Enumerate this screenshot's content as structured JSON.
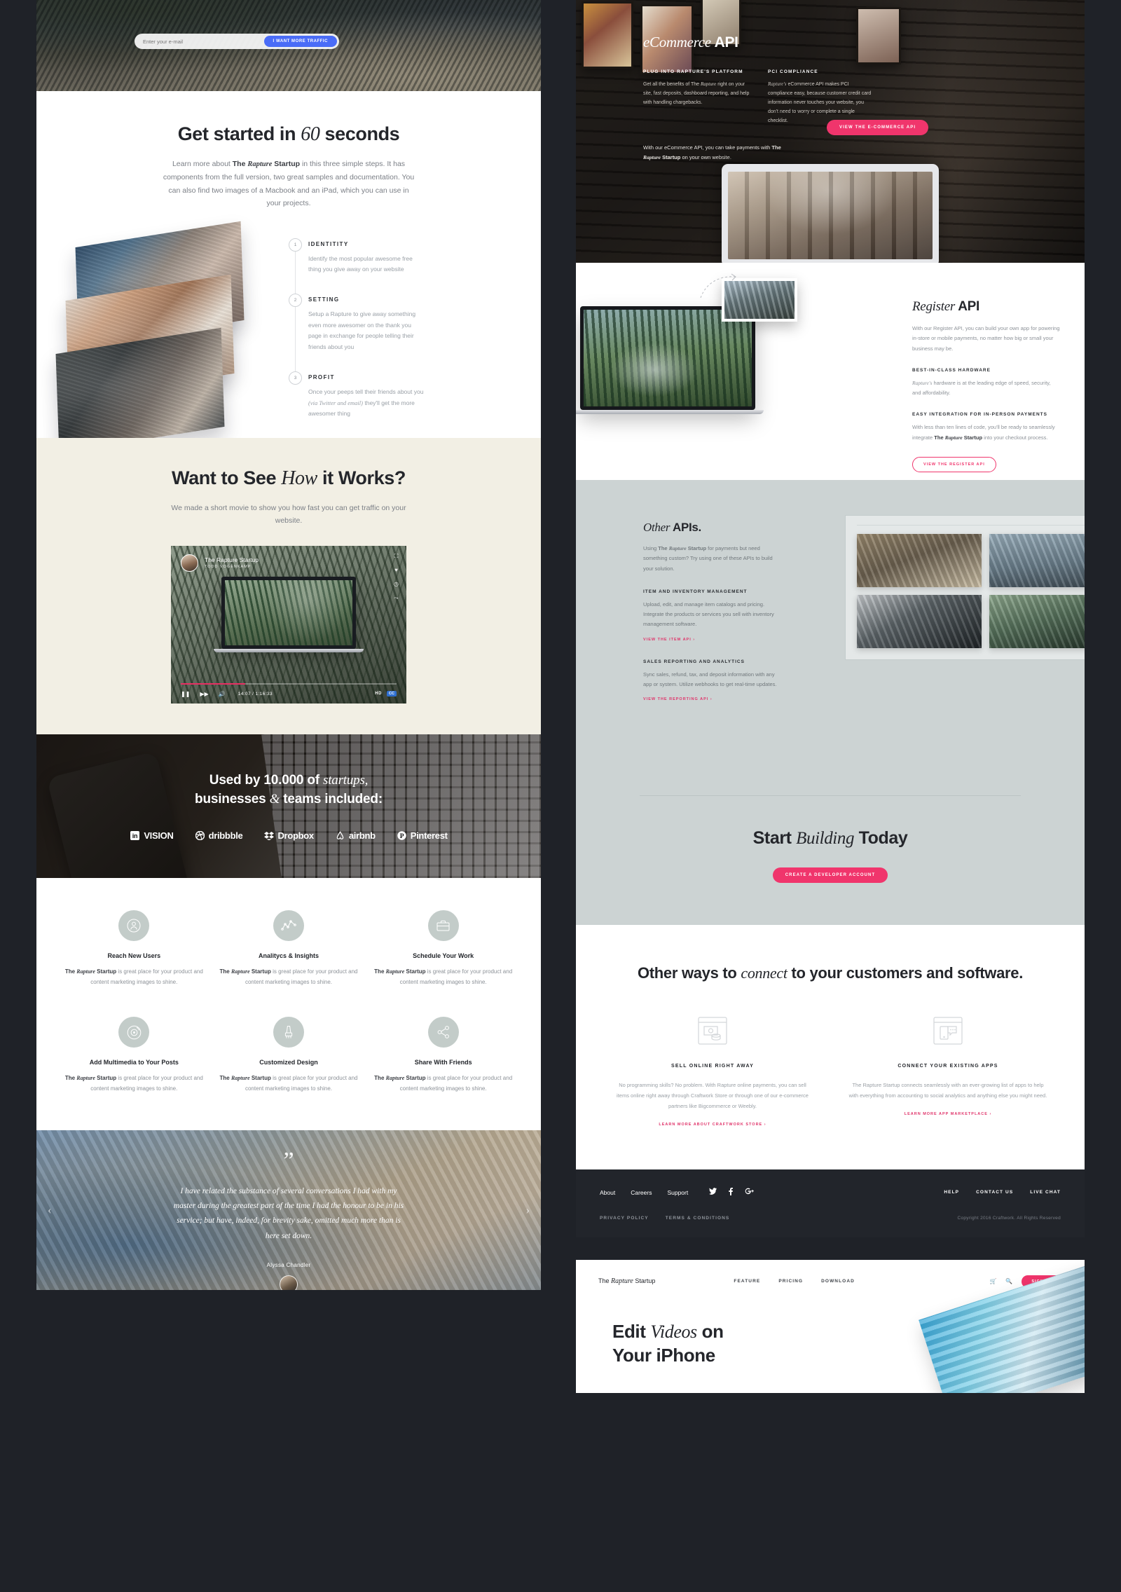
{
  "hero": {
    "email_placeholder": "Enter your e-mail",
    "cta": "I WANT MORE TRAFFIC"
  },
  "get_started": {
    "title_a": "Get started in ",
    "title_em": "60",
    "title_b": " seconds",
    "lead_a": "Learn more about ",
    "lead_bold_a": "The ",
    "lead_bold_em": "Rapture",
    "lead_bold_b": " Startup",
    "lead_b": " in this three simple steps. It has components from the full version, two great samples and documentation. You can also find two images of a Macbook and an iPad, which you can use in your projects.",
    "steps": [
      {
        "num": "1",
        "title": "IDENTITITY",
        "body": "Identify the most popular awesome free thing you give away on your website"
      },
      {
        "num": "2",
        "title": "SETTING",
        "body": "Setup a Rapture to give away something even more awesomer on the thank you page in exchange for people telling their friends about you"
      },
      {
        "num": "3",
        "title": "PROFIT",
        "body_a": "Once your peeps tell their friends about you ",
        "body_em": "(via Twitter and email)",
        "body_b": " they'll get the more awesomer thing"
      }
    ]
  },
  "video": {
    "title_a": "Want to See ",
    "title_em": "How",
    "title_b": " it Works?",
    "lead": "We made a short movie to show you how fast you can get traffic on your website.",
    "channel": "The Rapture Startup",
    "author": "TODD VOGENKAMP",
    "time": "14:07 / 1:16:33",
    "quality": "HD",
    "cc": "CC",
    "icons": [
      "fullscreen-icon",
      "heart-icon",
      "clock-icon",
      "share-icon"
    ]
  },
  "logos": {
    "title_a": "Used by 10.000 of ",
    "title_em": "startups,",
    "title_b": "businesses ",
    "title_em2": "&",
    "title_c": " teams included:",
    "items": [
      "in vision",
      "dribbble",
      "Dropbox",
      "airbnb",
      "Pinterest"
    ]
  },
  "features": [
    {
      "icon": "user-icon",
      "name": "Reach New Users",
      "t_bold_a": "The ",
      "t_bold_em": "Rapture",
      "t_bold_b": " Startup",
      "text": " is great place for your product and content marketing images to shine."
    },
    {
      "icon": "chart-line-icon",
      "name": "Analitycs & Insights",
      "t_bold_a": "The ",
      "t_bold_em": "Rapture",
      "t_bold_b": " Startup",
      "text": " is great place for your product and content marketing images to shine."
    },
    {
      "icon": "briefcase-icon",
      "name": "Schedule Your Work",
      "t_bold_a": "The ",
      "t_bold_em": "Rapture",
      "t_bold_b": " Startup",
      "text": " is great place for your product and content marketing images to shine."
    },
    {
      "icon": "disc-icon",
      "name": "Add Multimedia to Your Posts",
      "t_bold_a": "The ",
      "t_bold_em": "Rapture",
      "t_bold_b": " Startup",
      "text": " is great place for your product and content marketing images to shine."
    },
    {
      "icon": "brush-icon",
      "name": "Customized Design",
      "t_bold_a": "The ",
      "t_bold_em": "Rapture",
      "t_bold_b": " Startup",
      "text": " is great place for your product and content marketing images to shine."
    },
    {
      "icon": "share-nodes-icon",
      "name": "Share With Friends",
      "t_bold_a": "The ",
      "t_bold_em": "Rapture",
      "t_bold_b": " Startup",
      "text": " is great place for your product and content marketing images to shine."
    }
  ],
  "testimonial": {
    "quote_mark": "”",
    "quote": "I have related the substance of several conversations I had with my master during the greatest part of the time I had the honour to be in his service; but have, indeed, for brevity sake, omitted much more than is here set down.",
    "author": "Alyssa Chandler",
    "prev": "‹",
    "next": "›"
  },
  "ecommerce": {
    "title_em": "eCommerce",
    "title_b": " API",
    "col1_title": "PLUG INTO RAPTURE'S PLATFORM",
    "col1_body_a": "Get all the benefits of The ",
    "col1_body_em": "Rapture",
    "col1_body_b": " right on your site, fast deposits, dashboard reporting, and help with handling chargebacks.",
    "col2_title": "PCI COMPLIANCE",
    "col2_body_a": "Rapture's",
    "col2_body_b": " eCommerce API makes PCI compliance easy, because customer credit card information never touches your website, you don't need to worry or complete a single checklist.",
    "footer_a": "With our eCommerce API, you can take payments with ",
    "footer_bold_a": "The ",
    "footer_bold_em": "Rapture",
    "footer_bold_b": " Startup",
    "footer_b": " on your own website.",
    "cta": "VIEW THE E-COMMERCE API"
  },
  "register": {
    "title_em": "Register",
    "title_b": " API",
    "body": "With our Register API, you can build your own app for powering in-store or mobile payments, no matter how big or small your business may be.",
    "sub1": "BEST-IN-CLASS HARDWARE",
    "sub1_body_em": "Rapture's",
    "sub1_body": " hardware is at the leading edge of speed, security, and affordability.",
    "sub2": "EASY INTEGRATION FOR IN-PERSON PAYMENTS",
    "sub2_body_a": "With less than ten lines of code, you'll be ready to seamlessly integrate ",
    "sub2_bold_a": "The ",
    "sub2_bold_em": "Rapture",
    "sub2_bold_b": " Startup",
    "sub2_body_b": " into your checkout process.",
    "cta": "VIEW THE REGISTER API"
  },
  "other_apis": {
    "title_em": "Other",
    "title_b": " APIs.",
    "body_a": "Using ",
    "body_bold_a": "The ",
    "body_bold_em": "Rapture",
    "body_bold_b": " Startup",
    "body_b": " for payments but need something custom? Try using one of these APIs to build your solution.",
    "sub1": "ITEM AND INVENTORY MANAGEMENT",
    "sub1_body": "Upload, edit, and manage item catalogs and pricing. Integrate the products or services you sell with inventory management software.",
    "link1": "VIEW THE ITEM API ›",
    "sub2": "SALES REPORTING AND ANALYTICS",
    "sub2_body": "Sync sales, refund, tax, and deposit information with any app or system. Utilize webhooks to get real-time updates.",
    "link2": "VIEW THE REPORTING API ›"
  },
  "start_building": {
    "title_a": "Start ",
    "title_em": "Building",
    "title_b": " Today",
    "cta": "CREATE A DEVELOPER ACCOUNT"
  },
  "connect": {
    "title_a": "Other ways to ",
    "title_em": "connect",
    "title_b": " to your customers and software.",
    "cells": [
      {
        "icon": "money-window-icon",
        "title": "SELL ONLINE RIGHT AWAY",
        "body": "No programming skills? No problem. With Rapture online payments, you can sell items online right away through Craftwork Store or through one of our e-commerce partners like Bigcommerce or Weebly.",
        "link": "LEARN MORE ABOUT CRAFTWORK STORE ›"
      },
      {
        "icon": "app-chat-icon",
        "title": "CONNECT YOUR EXISTING APPS",
        "body": "The Rapture Startup connects seamlessly with an ever-growing list of apps to help with everything from accounting to social analytics and anything else you might need.",
        "link": "LEARN MORE APP MARKETPLACE ›"
      }
    ]
  },
  "footer": {
    "links": [
      "About",
      "Careers",
      "Support"
    ],
    "social": [
      "twitter-icon",
      "facebook-icon",
      "google-plus-icon"
    ],
    "right_links": [
      "HELP",
      "CONTACT US",
      "LIVE CHAT"
    ],
    "legal": [
      "PRIVACY POLICY",
      "TERMS & CONDITIONS"
    ],
    "copyright": "Copyright 2016 Craftwork. All Rights Reserved"
  },
  "next_page": {
    "brand_a": "The ",
    "brand_em": "Rapture",
    "brand_b": " Startup",
    "nav": [
      "FEATURE",
      "PRICING",
      "DOWNLOAD"
    ],
    "cart_icon": "cart-icon",
    "search_icon": "search-icon",
    "signup": "SIGN UP",
    "title_a": "Edit ",
    "title_em": "Videos",
    "title_b": " on",
    "title_line2": "Your iPhone"
  },
  "colors": {
    "accent_pink": "#f0356c",
    "accent_blue": "#4a6cf7",
    "cream": "#f2efe4",
    "slate": "#ccd3d3",
    "dark": "#22252b"
  }
}
